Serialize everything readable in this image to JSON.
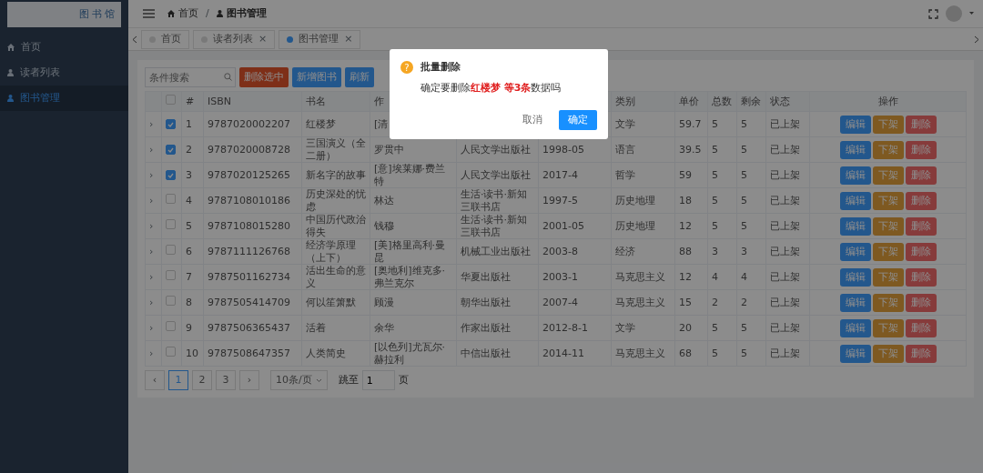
{
  "sidebar": {
    "logo_text": "图书馆",
    "items": [
      {
        "label": "首页",
        "selected": false
      },
      {
        "label": "读者列表",
        "selected": false
      },
      {
        "label": "图书管理",
        "selected": true
      }
    ]
  },
  "header": {
    "breadcrumb": [
      {
        "label": "首页"
      },
      {
        "label": "图书管理"
      }
    ],
    "separator": "/"
  },
  "tabs": [
    {
      "label": "首页",
      "selected": false
    },
    {
      "label": "读者列表",
      "close": "×",
      "selected": false
    },
    {
      "label": "图书管理",
      "close": "×",
      "selected": true
    }
  ],
  "toolbar": {
    "search": {
      "placeholder": "条件搜索"
    },
    "buttons": [
      {
        "label": "删除选中",
        "kind": "danger"
      },
      {
        "label": "新增图书",
        "kind": "primary"
      },
      {
        "label": "刷新",
        "kind": "primary"
      }
    ]
  },
  "table": {
    "header_checkbox": {
      "checked": false
    },
    "columns": [
      {},
      {},
      {
        "label": "#"
      },
      {
        "label": "ISBN"
      },
      {
        "label": "书名"
      },
      {
        "label": "作"
      },
      {},
      {},
      {
        "label": "类别"
      },
      {
        "label": "单价"
      },
      {
        "label": "总数"
      },
      {
        "label": "剩余"
      },
      {
        "label": "状态"
      },
      {
        "label": "操作"
      }
    ],
    "rows": [
      {
        "selected": true,
        "cells": [
          "›",
          "",
          "1",
          "9787020002207",
          "红楼梦",
          "[清",
          "",
          "",
          "文学",
          "59.7",
          "5",
          "5",
          "已上架"
        ],
        "actions": [
          {
            "label": "编辑",
            "kind": "edit"
          },
          {
            "label": "下架",
            "kind": "off"
          },
          {
            "label": "删除",
            "kind": "delete"
          }
        ]
      },
      {
        "selected": true,
        "cells": [
          "›",
          "",
          "2",
          "9787020008728",
          "三国演义（全二册）",
          "罗贯中",
          "人民文学出版社",
          "1998-05",
          "语言",
          "39.5",
          "5",
          "5",
          "已上架"
        ],
        "actions": [
          {
            "label": "编辑",
            "kind": "edit"
          },
          {
            "label": "下架",
            "kind": "off"
          },
          {
            "label": "删除",
            "kind": "delete"
          }
        ]
      },
      {
        "selected": true,
        "cells": [
          "›",
          "",
          "3",
          "9787020125265",
          "新名字的故事",
          "[意]埃莱娜·费兰特",
          "人民文学出版社",
          "2017-4",
          "哲学",
          "59",
          "5",
          "5",
          "已上架"
        ],
        "actions": [
          {
            "label": "编辑",
            "kind": "edit"
          },
          {
            "label": "下架",
            "kind": "off"
          },
          {
            "label": "删除",
            "kind": "delete"
          }
        ]
      },
      {
        "selected": false,
        "cells": [
          "›",
          "",
          "4",
          "9787108010186",
          "历史深处的忧虑",
          "林达",
          "生活·读书·新知三联书店",
          "1997-5",
          "历史地理",
          "18",
          "5",
          "5",
          "已上架"
        ],
        "actions": [
          {
            "label": "编辑",
            "kind": "edit"
          },
          {
            "label": "下架",
            "kind": "off"
          },
          {
            "label": "删除",
            "kind": "delete"
          }
        ]
      },
      {
        "selected": false,
        "cells": [
          "›",
          "",
          "5",
          "9787108015280",
          "中国历代政治得失",
          "钱穆",
          "生活·读书·新知三联书店",
          "2001-05",
          "历史地理",
          "12",
          "5",
          "5",
          "已上架"
        ],
        "actions": [
          {
            "label": "编辑",
            "kind": "edit"
          },
          {
            "label": "下架",
            "kind": "off"
          },
          {
            "label": "删除",
            "kind": "delete"
          }
        ]
      },
      {
        "selected": false,
        "cells": [
          "›",
          "",
          "6",
          "9787111126768",
          "经济学原理（上下）",
          "[美]格里高利·曼昆",
          "机械工业出版社",
          "2003-8",
          "经济",
          "88",
          "3",
          "3",
          "已上架"
        ],
        "actions": [
          {
            "label": "编辑",
            "kind": "edit"
          },
          {
            "label": "下架",
            "kind": "off"
          },
          {
            "label": "删除",
            "kind": "delete"
          }
        ]
      },
      {
        "selected": false,
        "cells": [
          "›",
          "",
          "7",
          "9787501162734",
          "活出生命的意义",
          "[奥地利]维克多·弗兰克尔",
          "华夏出版社",
          "2003-1",
          "马克思主义",
          "12",
          "4",
          "4",
          "已上架"
        ],
        "actions": [
          {
            "label": "编辑",
            "kind": "edit"
          },
          {
            "label": "下架",
            "kind": "off"
          },
          {
            "label": "删除",
            "kind": "delete"
          }
        ]
      },
      {
        "selected": false,
        "cells": [
          "›",
          "",
          "8",
          "9787505414709",
          "何以笙箫默",
          "顾漫",
          "朝华出版社",
          "2007-4",
          "马克思主义",
          "15",
          "2",
          "2",
          "已上架"
        ],
        "actions": [
          {
            "label": "编辑",
            "kind": "edit"
          },
          {
            "label": "下架",
            "kind": "off"
          },
          {
            "label": "删除",
            "kind": "delete"
          }
        ]
      },
      {
        "selected": false,
        "cells": [
          "›",
          "",
          "9",
          "9787506365437",
          "活着",
          "余华",
          "作家出版社",
          "2012-8-1",
          "文学",
          "20",
          "5",
          "5",
          "已上架"
        ],
        "actions": [
          {
            "label": "编辑",
            "kind": "edit"
          },
          {
            "label": "下架",
            "kind": "off"
          },
          {
            "label": "删除",
            "kind": "delete"
          }
        ]
      },
      {
        "selected": false,
        "cells": [
          "›",
          "",
          "10",
          "9787508647357",
          "人类简史",
          "[以色列]尤瓦尔·赫拉利",
          "中信出版社",
          "2014-11",
          "马克思主义",
          "68",
          "5",
          "5",
          "已上架"
        ],
        "actions": [
          {
            "label": "编辑",
            "kind": "edit"
          },
          {
            "label": "下架",
            "kind": "off"
          },
          {
            "label": "删除",
            "kind": "delete"
          }
        ]
      }
    ]
  },
  "pagination": {
    "prev": "‹",
    "pages": [
      {
        "label": "1",
        "selected": true
      },
      {
        "label": "2",
        "selected": false
      },
      {
        "label": "3",
        "selected": false
      }
    ],
    "next": "›",
    "page_size": "10条/页",
    "jump_label": "跳至",
    "jump_value": "1",
    "jump_suffix": "页"
  },
  "dialog": {
    "title": "批量删除",
    "icon": "?",
    "message": "确定要删除**红楼梦 等3条**数据吗",
    "buttons": [
      {
        "label": "取消",
        "kind": "text"
      },
      {
        "label": "确定",
        "kind": "primary"
      }
    ]
  }
}
